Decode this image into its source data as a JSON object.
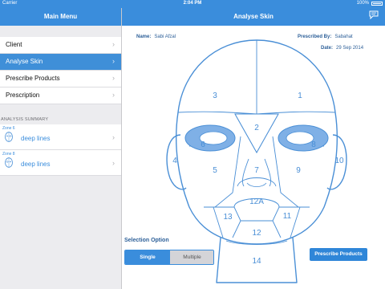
{
  "status_bar": {
    "carrier": "Carrier",
    "time": "2:04 PM",
    "battery": "100%"
  },
  "left_nav": {
    "title": "Main Menu"
  },
  "right_nav": {
    "title": "Analyse Skin"
  },
  "menu": {
    "items": [
      {
        "label": "Client"
      },
      {
        "label": "Analyse Skin",
        "active": true
      },
      {
        "label": "Prescribe Products"
      },
      {
        "label": "Prescription"
      }
    ]
  },
  "analysis_summary": {
    "header": "ANALYSIS SUMMARY",
    "items": [
      {
        "zone": "Zone 6",
        "description": "deep lines"
      },
      {
        "zone": "Zone 8",
        "description": "deep lines"
      }
    ]
  },
  "client_info": {
    "name_label": "Name:",
    "name_value": "Sabi Afzal",
    "prescribed_label": "Prescribed By:",
    "prescribed_value": "Sabahat",
    "date_label": "Date:",
    "date_value": "29 Sep 2014"
  },
  "face_zones": {
    "z1": "1",
    "z2": "2",
    "z3": "3",
    "z4": "4",
    "z5": "5",
    "z6": "6",
    "z7": "7",
    "z8": "8",
    "z9": "9",
    "z10": "10",
    "z11": "11",
    "z12": "12",
    "z12a": "12A",
    "z13": "13",
    "z14": "14"
  },
  "selection": {
    "title": "Selection Option",
    "single": "Single",
    "multiple": "Multiple",
    "selected": "Single"
  },
  "prescribe_button": "Prescribe Products",
  "colors": {
    "accent": "#3a8ddc",
    "face_stroke": "#4a8fd6",
    "selected_zone": "#7fb0e6"
  }
}
